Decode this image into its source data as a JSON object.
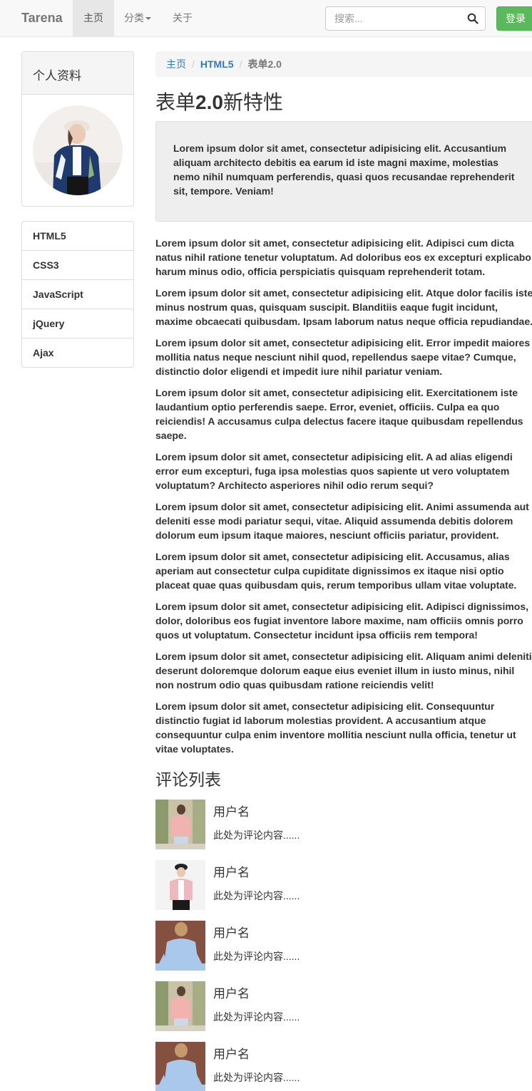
{
  "navbar": {
    "brand": "Tarena",
    "home": "主页",
    "category": "分类",
    "about": "关于",
    "search_placeholder": "搜索...",
    "login": "登录"
  },
  "sidebar": {
    "panel_title": "个人资料",
    "items": [
      "HTML5",
      "CSS3",
      "JavaScript",
      "jQuery",
      "Ajax"
    ]
  },
  "breadcrumb": {
    "home": "主页",
    "section": "HTML5",
    "current": "表单2.0"
  },
  "main": {
    "title_pre": "表单",
    "title_bold": "2.0",
    "title_post": "新特性",
    "jumbotron": "Lorem ipsum dolor sit amet, consectetur adipisicing elit. Accusantium aliquam architecto debitis ea earum id iste magni maxime, molestias nemo nihil numquam perferendis, quasi quos recusandae reprehenderit sit, tempore. Veniam!",
    "paragraphs": [
      "Lorem ipsum dolor sit amet, consectetur adipisicing elit. Adipisci cum dicta natus nihil ratione tenetur voluptatum. Ad doloribus eos ex excepturi explicabo harum minus odio, officia perspiciatis quisquam reprehenderit totam.",
      "Lorem ipsum dolor sit amet, consectetur adipisicing elit. Atque dolor facilis iste minus nostrum quas, quisquam suscipit. Blanditiis eaque fugit incidunt, maxime obcaecati quibusdam. Ipsam laborum natus neque officia repudiandae.",
      "Lorem ipsum dolor sit amet, consectetur adipisicing elit. Error impedit maiores mollitia natus neque nesciunt nihil quod, repellendus saepe vitae? Cumque, distinctio dolor eligendi et impedit iure nihil pariatur veniam.",
      "Lorem ipsum dolor sit amet, consectetur adipisicing elit. Exercitationem iste laudantium optio perferendis saepe. Error, eveniet, officiis. Culpa ea quo reiciendis! A accusamus culpa delectus facere itaque quibusdam repellendus saepe.",
      "Lorem ipsum dolor sit amet, consectetur adipisicing elit. A ad alias eligendi error eum excepturi, fuga ipsa molestias quos sapiente ut vero voluptatem voluptatum? Architecto asperiores nihil odio rerum sequi?",
      "Lorem ipsum dolor sit amet, consectetur adipisicing elit. Animi assumenda aut deleniti esse modi pariatur sequi, vitae. Aliquid assumenda debitis dolorem dolorum eum ipsum itaque maiores, nesciunt officiis pariatur, provident.",
      "Lorem ipsum dolor sit amet, consectetur adipisicing elit. Accusamus, alias aperiam aut consectetur culpa cupiditate dignissimos ex itaque nisi optio placeat quae quas quibusdam quis, rerum temporibus ullam vitae voluptate.",
      "Lorem ipsum dolor sit amet, consectetur adipisicing elit. Adipisci dignissimos, dolor, doloribus eos fugiat inventore labore maxime, nam officiis omnis porro quos ut voluptatum. Consectetur incidunt ipsa officiis rem tempora!",
      "Lorem ipsum dolor sit amet, consectetur adipisicing elit. Aliquam animi deleniti deserunt doloremque dolorum eaque eius eveniet illum in iusto minus, nihil non nostrum odio quas quibusdam ratione reiciendis velit!",
      "Lorem ipsum dolor sit amet, consectetur adipisicing elit. Consequuntur distinctio fugiat id laborum molestias provident. A accusantium atque consequuntur culpa enim inventore mollitia nesciunt nulla officia, tenetur ut vitae voluptates."
    ]
  },
  "comments": {
    "title": "评论列表",
    "items": [
      {
        "user": "用户名",
        "text": "此处为评论内容......"
      },
      {
        "user": "用户名",
        "text": "此处为评论内容......"
      },
      {
        "user": "用户名",
        "text": "此处为评论内容......"
      },
      {
        "user": "用户名",
        "text": "此处为评论内容......"
      },
      {
        "user": "用户名",
        "text": "此处为评论内容......"
      }
    ]
  },
  "colors": {
    "login": "#5cb85c",
    "link": "#337ab7",
    "navbar_bg": "#f8f8f8"
  }
}
